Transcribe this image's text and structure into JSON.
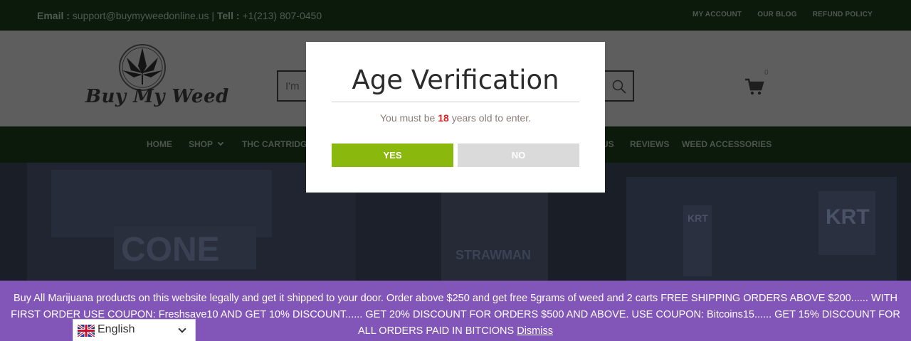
{
  "topbar": {
    "email_label": "Email :",
    "email_value": "support@buymyweedonline.us",
    "separator": "|",
    "tel_label": "Tell :",
    "tel_value": "+1(213) 807-0450",
    "links": [
      "MY ACCOUNT",
      "OUR BLOG",
      "REFUND POLICY"
    ]
  },
  "header": {
    "logo_text": "Buy My Weed",
    "search_placeholder": "I'm",
    "cart_count": "0"
  },
  "nav": {
    "items": [
      "HOME",
      "SHOP",
      "THC CARTRIDGE",
      "US",
      "REVIEWS",
      "WEED ACCESSORIES"
    ]
  },
  "hero": {
    "texts": [
      "CONE",
      "STRAWMAN",
      "KRT",
      "KRT"
    ]
  },
  "modal": {
    "title": "Age Verification",
    "msg_before": "You must be",
    "age": "18",
    "msg_after": "years old to enter.",
    "yes_label": "YES",
    "no_label": "NO"
  },
  "notice": {
    "text": "Buy All Marijuana products on this website legally and get it shipped to your door. Order above $250 and get free 5grams of weed and 2 carts FREE SHIPPING ORDERS ABOVE $200...... WITH FIRST ORDER USE COUPON: Freshsave10 AND GET 10% DISCOUNT...... GET 20% DISCOUNT FOR ORDERS $500 AND ABOVE. USE COUPON: Bitcoins15...... GET 15% DISCOUNT FOR ALL ORDERS PAID IN BITCIONS",
    "dismiss_label": "Dismiss"
  },
  "language": {
    "selected": "English",
    "flag_icon": "uk-flag-icon"
  },
  "colors": {
    "accent_green": "#8ab80d",
    "notice_purple": "#8255b8",
    "age_red": "#dd2222"
  }
}
